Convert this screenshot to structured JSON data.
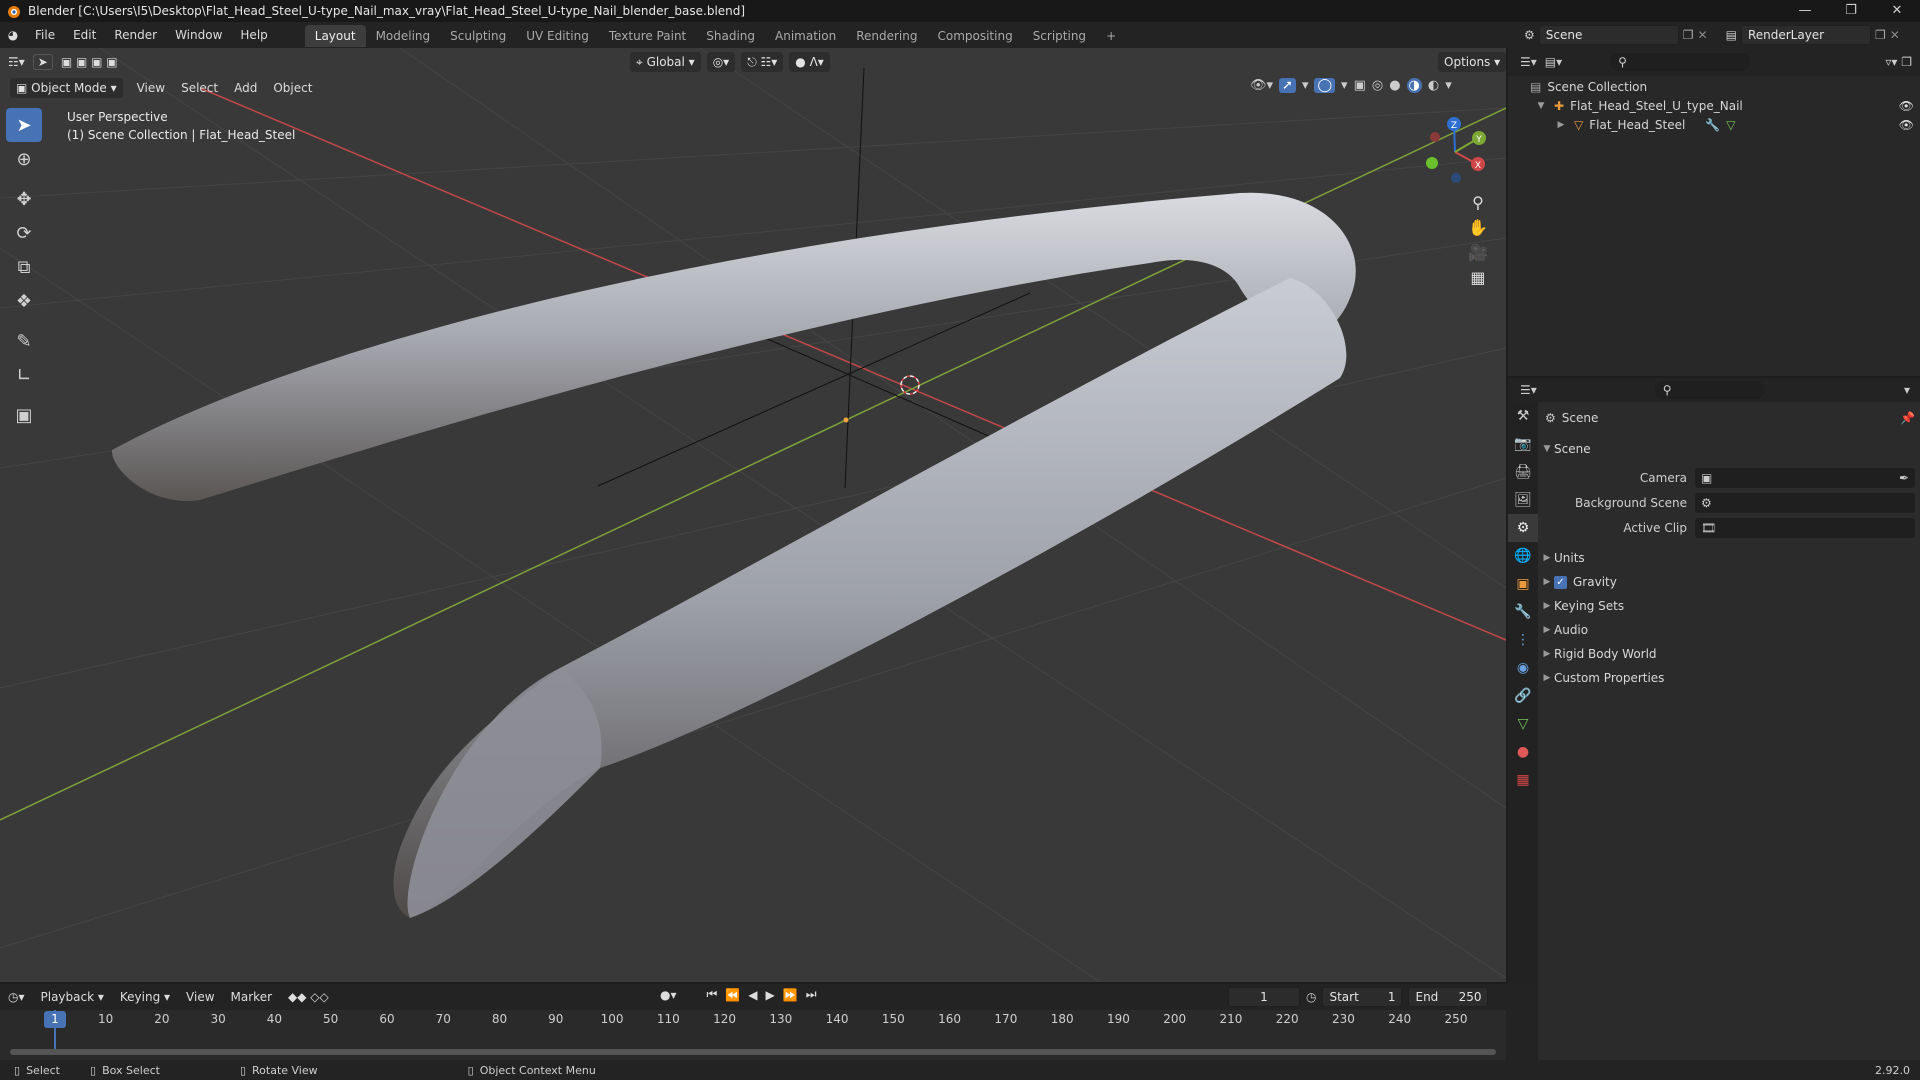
{
  "window": {
    "title": "Blender [C:\\Users\\I5\\Desktop\\Flat_Head_Steel_U-type_Nail_max_vray\\Flat_Head_Steel_U-type_Nail_blender_base.blend]"
  },
  "menu": {
    "items": [
      "File",
      "Edit",
      "Render",
      "Window",
      "Help"
    ],
    "workspaces": [
      "Layout",
      "Modeling",
      "Sculpting",
      "UV Editing",
      "Texture Paint",
      "Shading",
      "Animation",
      "Rendering",
      "Compositing",
      "Scripting"
    ],
    "add_tab": "+",
    "scene": "Scene",
    "render_layer": "RenderLayer"
  },
  "viewport": {
    "mode": "Object Mode",
    "menus": [
      "View",
      "Select",
      "Add",
      "Object"
    ],
    "transform_orientation": "Global",
    "options_label": "Options",
    "overlay_line1": "User Perspective",
    "overlay_line2": "(1) Scene Collection | Flat_Head_Steel",
    "gizmo": {
      "x": "X",
      "y": "Y",
      "z": "Z"
    }
  },
  "outliner": {
    "root": "Scene Collection",
    "collection": "Flat_Head_Steel_U_type_Nail",
    "object": "Flat_Head_Steel"
  },
  "properties": {
    "header": "Scene",
    "panel": "Scene",
    "fields": [
      {
        "label": "Camera",
        "value": ""
      },
      {
        "label": "Background Scene",
        "value": ""
      },
      {
        "label": "Active Clip",
        "value": ""
      }
    ],
    "subpanels": [
      "Units",
      "Gravity",
      "Keying Sets",
      "Audio",
      "Rigid Body World",
      "Custom Properties"
    ],
    "gravity_checked": true
  },
  "timeline": {
    "menus": [
      "Playback",
      "Keying",
      "View",
      "Marker"
    ],
    "current_frame": "1",
    "start_label": "Start",
    "start": "1",
    "end_label": "End",
    "end": "250",
    "ruler": [
      "1",
      "10",
      "20",
      "30",
      "40",
      "50",
      "60",
      "70",
      "80",
      "90",
      "100",
      "110",
      "120",
      "130",
      "140",
      "150",
      "160",
      "170",
      "180",
      "190",
      "200",
      "210",
      "220",
      "230",
      "240",
      "250"
    ]
  },
  "status": {
    "select": "Select",
    "box_select": "Box Select",
    "rotate": "Rotate View",
    "context_menu": "Object Context Menu",
    "version": "2.92.0"
  },
  "colors": {
    "accent": "#4772b3",
    "x_axis": "#c24848",
    "y_axis": "#7da33a",
    "viewport_bg": "#393939"
  }
}
